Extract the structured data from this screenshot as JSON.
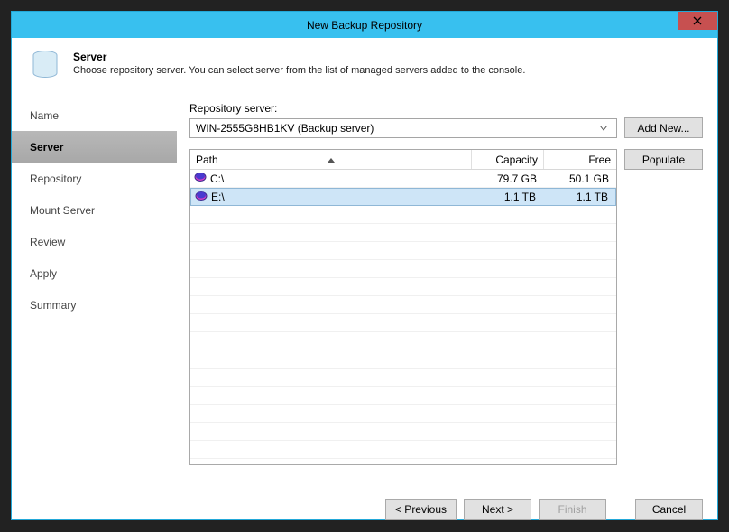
{
  "window": {
    "title": "New Backup Repository"
  },
  "header": {
    "title": "Server",
    "description": "Choose repository server. You can select server from the list of managed servers added to the console."
  },
  "sidebar": {
    "items": [
      {
        "label": "Name",
        "active": false
      },
      {
        "label": "Server",
        "active": true
      },
      {
        "label": "Repository",
        "active": false
      },
      {
        "label": "Mount Server",
        "active": false
      },
      {
        "label": "Review",
        "active": false
      },
      {
        "label": "Apply",
        "active": false
      },
      {
        "label": "Summary",
        "active": false
      }
    ]
  },
  "main": {
    "server_label": "Repository server:",
    "server_value": "WIN-2555G8HB1KV (Backup server)",
    "add_new_label": "Add New...",
    "populate_label": "Populate",
    "columns": {
      "path": "Path",
      "capacity": "Capacity",
      "free": "Free"
    },
    "drives": [
      {
        "path": "C:\\",
        "capacity": "79.7 GB",
        "free": "50.1 GB",
        "selected": false
      },
      {
        "path": "E:\\",
        "capacity": "1.1 TB",
        "free": "1.1 TB",
        "selected": true
      }
    ]
  },
  "footer": {
    "previous": "< Previous",
    "next": "Next >",
    "finish": "Finish",
    "cancel": "Cancel"
  }
}
